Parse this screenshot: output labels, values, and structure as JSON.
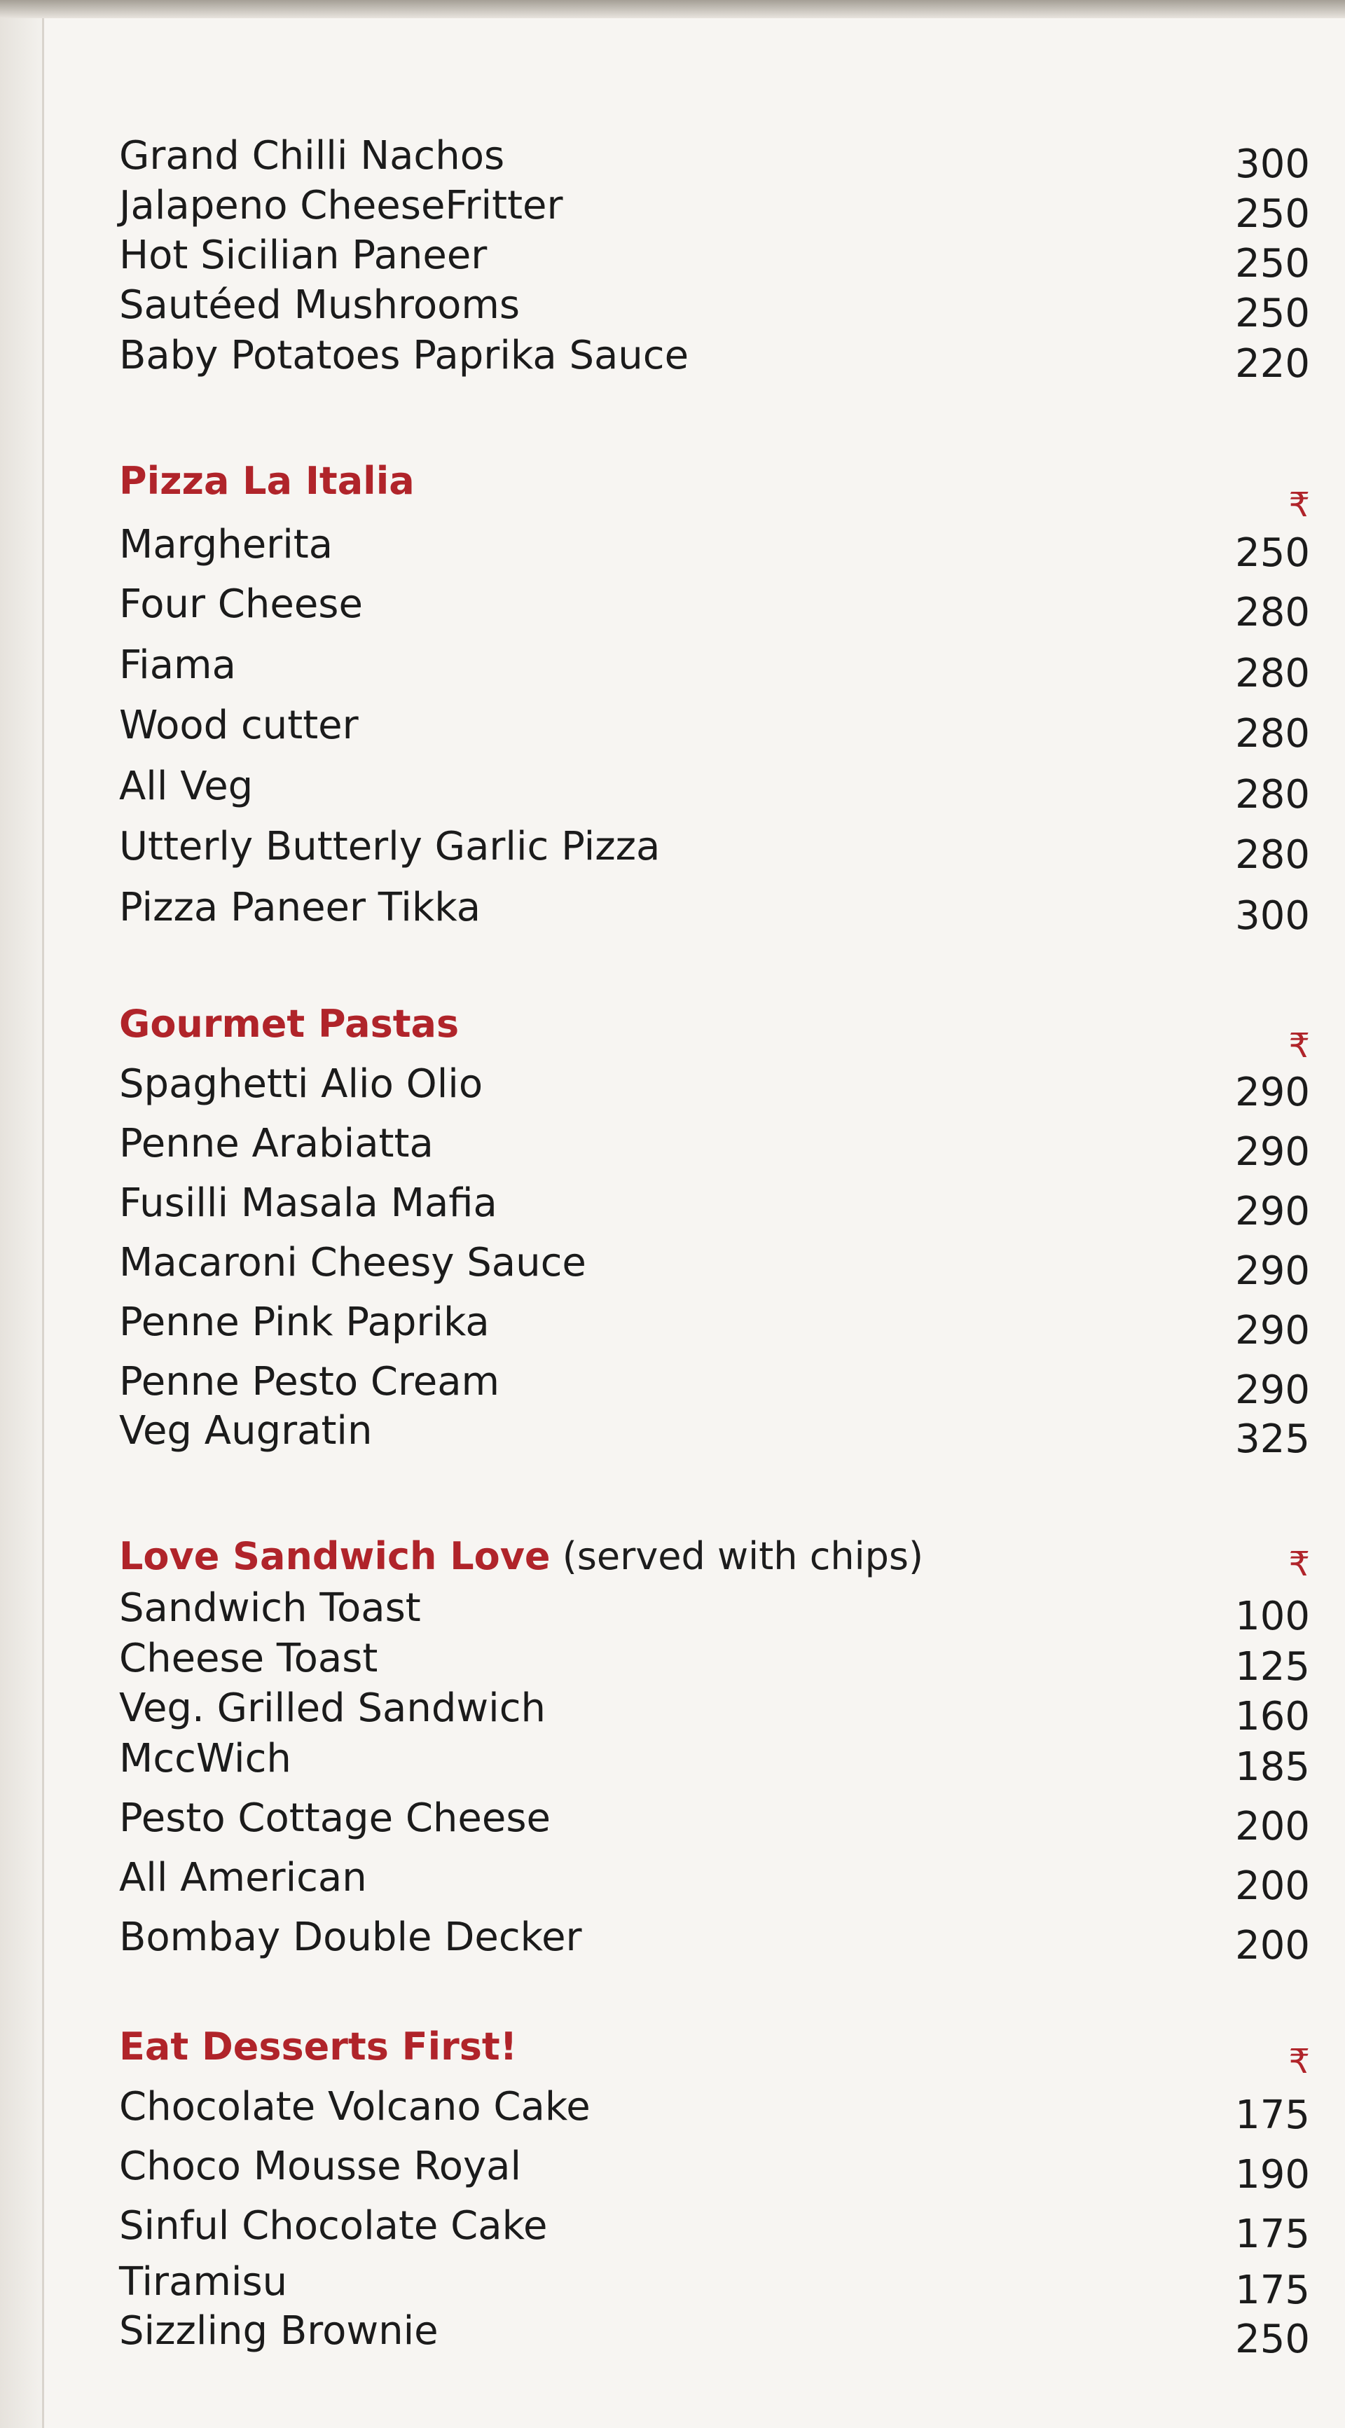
{
  "sections": [
    {
      "title": "",
      "note": "",
      "currency": "",
      "items": [
        {
          "name": "Grand Chilli Nachos",
          "price": "300"
        },
        {
          "name": "Jalapeno CheeseFritter",
          "price": "250"
        },
        {
          "name": "Hot Sicilian Paneer",
          "price": "250"
        },
        {
          "name": "Sautéed Mushrooms",
          "price": "250"
        },
        {
          "name": "Baby Potatoes Paprika Sauce",
          "price": "220"
        }
      ]
    },
    {
      "title": "Pizza La Italia",
      "note": "",
      "currency": "₹",
      "items": [
        {
          "name": "Margherita",
          "price": "250"
        },
        {
          "name": "Four Cheese",
          "price": "280"
        },
        {
          "name": "Fiama",
          "price": "280"
        },
        {
          "name": "Wood cutter",
          "price": "280"
        },
        {
          "name": "All Veg",
          "price": "280"
        },
        {
          "name": "Utterly Butterly Garlic Pizza",
          "price": "280"
        },
        {
          "name": "Pizza Paneer Tikka",
          "price": "300"
        }
      ]
    },
    {
      "title": "Gourmet Pastas",
      "note": "",
      "currency": "₹",
      "items": [
        {
          "name": "Spaghetti Alio Olio",
          "price": "290"
        },
        {
          "name": "Penne Arabiatta",
          "price": "290"
        },
        {
          "name": "Fusilli Masala Mafia",
          "price": "290"
        },
        {
          "name": "Macaroni Cheesy Sauce",
          "price": "290"
        },
        {
          "name": "Penne Pink Paprika",
          "price": "290"
        },
        {
          "name": "Penne Pesto Cream",
          "price": "290"
        },
        {
          "name": "Veg Augratin",
          "price": "325"
        }
      ]
    },
    {
      "title": "Love Sandwich Love",
      "note": " (served with chips)",
      "currency": "₹",
      "items": [
        {
          "name": "Sandwich Toast",
          "price": "100"
        },
        {
          "name": "Cheese Toast",
          "price": "125"
        },
        {
          "name": "Veg. Grilled Sandwich",
          "price": "160"
        },
        {
          "name": "MccWich",
          "price": "185"
        },
        {
          "name": "Pesto Cottage Cheese",
          "price": "200"
        },
        {
          "name": "All American",
          "price": "200"
        },
        {
          "name": "Bombay Double Decker",
          "price": "200"
        }
      ]
    },
    {
      "title": "Eat Desserts First!",
      "note": "",
      "currency": "₹",
      "items": [
        {
          "name": "Chocolate Volcano Cake",
          "price": "175"
        },
        {
          "name": "Choco Mousse Royal",
          "price": "190"
        },
        {
          "name": "Sinful Chocolate Cake",
          "price": "175"
        },
        {
          "name": "Tiramisu",
          "price": "175"
        },
        {
          "name": "Sizzling Brownie",
          "price": "250"
        }
      ]
    }
  ]
}
